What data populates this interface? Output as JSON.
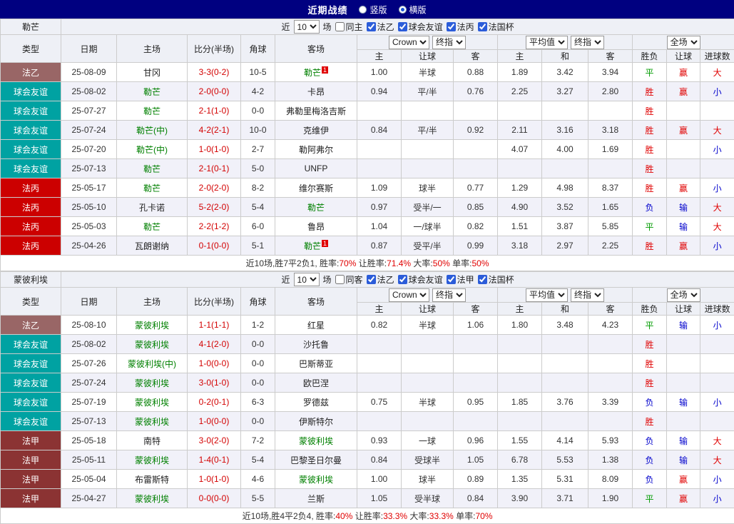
{
  "titlebar": {
    "title": "近期战绩",
    "options": [
      {
        "label": "竖版",
        "selected": false
      },
      {
        "label": "横版",
        "selected": true
      }
    ]
  },
  "colors": {
    "navy": "#000080",
    "win": "#e00000",
    "lose": "#0000cc",
    "draw": "#009b00",
    "score": "#d30000",
    "focus_team": "#008000",
    "leagues": {
      "法乙": "#996666",
      "球会友谊": "#00a2a2",
      "法丙": "#cc0000",
      "法甲": "#8b3333"
    }
  },
  "ui": {
    "near": "近",
    "matches_suffix": "场",
    "col_type": "类型",
    "col_date": "日期",
    "col_home": "主场",
    "col_score": "比分(半场)",
    "col_corner": "角球",
    "col_away": "客场",
    "select_odds": "Crown",
    "select_stage": "终指",
    "select_avg": "平均值",
    "select_scope": "全场",
    "sub_home": "主",
    "sub_handicap": "让球",
    "sub_away": "客",
    "sub_avg_home": "主",
    "sub_avg_draw": "和",
    "sub_avg_away": "客",
    "sub_result": "胜负",
    "sub_let": "让球",
    "sub_goals": "进球数"
  },
  "tables": [
    {
      "team": "勒芒",
      "filter": {
        "count": "10",
        "same_label": "同主",
        "same_checked": false,
        "leagues": [
          {
            "label": "法乙",
            "checked": true
          },
          {
            "label": "球会友谊",
            "checked": true
          },
          {
            "label": "法丙",
            "checked": true
          },
          {
            "label": "法国杯",
            "checked": true
          }
        ]
      },
      "rows": [
        {
          "league": "法乙",
          "date": "25-08-09",
          "home": "甘冈",
          "score": "3-3(0-2)",
          "corner": "10-5",
          "away": "勒芒",
          "badge": "1",
          "odds": [
            "1.00",
            "半球",
            "0.88"
          ],
          "avg": [
            "1.89",
            "3.42",
            "3.94"
          ],
          "res": "平",
          "let": "赢",
          "goals": "大"
        },
        {
          "league": "球会友谊",
          "date": "25-08-02",
          "home": "勒芒",
          "score": "2-0(0-0)",
          "corner": "4-2",
          "away": "卡昂",
          "odds": [
            "0.94",
            "平/半",
            "0.76"
          ],
          "avg": [
            "2.25",
            "3.27",
            "2.80"
          ],
          "res": "胜",
          "let": "赢",
          "goals": "小"
        },
        {
          "league": "球会友谊",
          "date": "25-07-27",
          "home": "勒芒",
          "score": "2-1(1-0)",
          "corner": "0-0",
          "away": "弗勒里梅洛吉斯",
          "odds": [
            "",
            "",
            ""
          ],
          "avg": [
            "",
            "",
            ""
          ],
          "res": "胜",
          "let": "",
          "goals": ""
        },
        {
          "league": "球会友谊",
          "date": "25-07-24",
          "home": "勒芒(中)",
          "score": "4-2(2-1)",
          "corner": "10-0",
          "away": "克维伊",
          "odds": [
            "0.84",
            "平/半",
            "0.92"
          ],
          "avg": [
            "2.11",
            "3.16",
            "3.18"
          ],
          "res": "胜",
          "let": "赢",
          "goals": "大"
        },
        {
          "league": "球会友谊",
          "date": "25-07-20",
          "home": "勒芒(中)",
          "score": "1-0(1-0)",
          "corner": "2-7",
          "away": "勒阿弗尔",
          "odds": [
            "",
            "",
            ""
          ],
          "avg": [
            "4.07",
            "4.00",
            "1.69"
          ],
          "res": "胜",
          "let": "",
          "goals": "小"
        },
        {
          "league": "球会友谊",
          "date": "25-07-13",
          "home": "勒芒",
          "score": "2-1(0-1)",
          "corner": "5-0",
          "away": "UNFP",
          "odds": [
            "",
            "",
            ""
          ],
          "avg": [
            "",
            "",
            ""
          ],
          "res": "胜",
          "let": "",
          "goals": ""
        },
        {
          "league": "法丙",
          "date": "25-05-17",
          "home": "勒芒",
          "score": "2-0(2-0)",
          "corner": "8-2",
          "away": "维尔赛斯",
          "odds": [
            "1.09",
            "球半",
            "0.77"
          ],
          "avg": [
            "1.29",
            "4.98",
            "8.37"
          ],
          "res": "胜",
          "let": "赢",
          "goals": "小"
        },
        {
          "league": "法丙",
          "date": "25-05-10",
          "home": "孔卡诺",
          "score": "5-2(2-0)",
          "corner": "5-4",
          "away": "勒芒",
          "odds": [
            "0.97",
            "受半/一",
            "0.85"
          ],
          "avg": [
            "4.90",
            "3.52",
            "1.65"
          ],
          "res": "负",
          "let": "输",
          "goals": "大"
        },
        {
          "league": "法丙",
          "date": "25-05-03",
          "home": "勒芒",
          "score": "2-2(1-2)",
          "corner": "6-0",
          "away": "鲁昂",
          "odds": [
            "1.04",
            "一/球半",
            "0.82"
          ],
          "avg": [
            "1.51",
            "3.87",
            "5.85"
          ],
          "res": "平",
          "let": "输",
          "goals": "大"
        },
        {
          "league": "法丙",
          "date": "25-04-26",
          "home": "瓦朗谢纳",
          "score": "0-1(0-0)",
          "corner": "5-1",
          "away": "勒芒",
          "badge": "1",
          "odds": [
            "0.87",
            "受平/半",
            "0.99"
          ],
          "avg": [
            "3.18",
            "2.97",
            "2.25"
          ],
          "res": "胜",
          "let": "赢",
          "goals": "小"
        }
      ],
      "summary": [
        {
          "t": "近10场,胜7平2负1, 胜率:",
          "red": false
        },
        {
          "t": "70%",
          "red": true
        },
        {
          "t": " 让胜率:",
          "red": false
        },
        {
          "t": "71.4%",
          "red": true
        },
        {
          "t": " 大率:",
          "red": false
        },
        {
          "t": "50%",
          "red": true
        },
        {
          "t": " 单率:",
          "red": false
        },
        {
          "t": "50%",
          "red": true
        }
      ]
    },
    {
      "team": "蒙彼利埃",
      "filter": {
        "count": "10",
        "same_label": "同客",
        "same_checked": false,
        "leagues": [
          {
            "label": "法乙",
            "checked": true
          },
          {
            "label": "球会友谊",
            "checked": true
          },
          {
            "label": "法甲",
            "checked": true
          },
          {
            "label": "法国杯",
            "checked": true
          }
        ]
      },
      "rows": [
        {
          "league": "法乙",
          "date": "25-08-10",
          "home": "蒙彼利埃",
          "score": "1-1(1-1)",
          "corner": "1-2",
          "away": "红星",
          "odds": [
            "0.82",
            "半球",
            "1.06"
          ],
          "avg": [
            "1.80",
            "3.48",
            "4.23"
          ],
          "res": "平",
          "let": "输",
          "goals": "小"
        },
        {
          "league": "球会友谊",
          "date": "25-08-02",
          "home": "蒙彼利埃",
          "score": "4-1(2-0)",
          "corner": "0-0",
          "away": "沙托鲁",
          "odds": [
            "",
            "",
            ""
          ],
          "avg": [
            "",
            "",
            ""
          ],
          "res": "胜",
          "let": "",
          "goals": ""
        },
        {
          "league": "球会友谊",
          "date": "25-07-26",
          "home": "蒙彼利埃(中)",
          "score": "1-0(0-0)",
          "corner": "0-0",
          "away": "巴斯蒂亚",
          "odds": [
            "",
            "",
            ""
          ],
          "avg": [
            "",
            "",
            ""
          ],
          "res": "胜",
          "let": "",
          "goals": ""
        },
        {
          "league": "球会友谊",
          "date": "25-07-24",
          "home": "蒙彼利埃",
          "score": "3-0(1-0)",
          "corner": "0-0",
          "away": "欧巴涅",
          "odds": [
            "",
            "",
            ""
          ],
          "avg": [
            "",
            "",
            ""
          ],
          "res": "胜",
          "let": "",
          "goals": ""
        },
        {
          "league": "球会友谊",
          "date": "25-07-19",
          "home": "蒙彼利埃",
          "score": "0-2(0-1)",
          "corner": "6-3",
          "away": "罗德兹",
          "odds": [
            "0.75",
            "半球",
            "0.95"
          ],
          "avg": [
            "1.85",
            "3.76",
            "3.39"
          ],
          "res": "负",
          "let": "输",
          "goals": "小"
        },
        {
          "league": "球会友谊",
          "date": "25-07-13",
          "home": "蒙彼利埃",
          "score": "1-0(0-0)",
          "corner": "0-0",
          "away": "伊斯特尔",
          "odds": [
            "",
            "",
            ""
          ],
          "avg": [
            "",
            "",
            ""
          ],
          "res": "胜",
          "let": "",
          "goals": ""
        },
        {
          "league": "法甲",
          "date": "25-05-18",
          "home": "南特",
          "score": "3-0(2-0)",
          "corner": "7-2",
          "away": "蒙彼利埃",
          "odds": [
            "0.93",
            "一球",
            "0.96"
          ],
          "avg": [
            "1.55",
            "4.14",
            "5.93"
          ],
          "res": "负",
          "let": "输",
          "goals": "大"
        },
        {
          "league": "法甲",
          "date": "25-05-11",
          "home": "蒙彼利埃",
          "score": "1-4(0-1)",
          "corner": "5-4",
          "away": "巴黎圣日尔曼",
          "odds": [
            "0.84",
            "受球半",
            "1.05"
          ],
          "avg": [
            "6.78",
            "5.53",
            "1.38"
          ],
          "res": "负",
          "let": "输",
          "goals": "大"
        },
        {
          "league": "法甲",
          "date": "25-05-04",
          "home": "布雷斯特",
          "score": "1-0(1-0)",
          "corner": "4-6",
          "away": "蒙彼利埃",
          "odds": [
            "1.00",
            "球半",
            "0.89"
          ],
          "avg": [
            "1.35",
            "5.31",
            "8.09"
          ],
          "res": "负",
          "let": "赢",
          "goals": "小"
        },
        {
          "league": "法甲",
          "date": "25-04-27",
          "home": "蒙彼利埃",
          "score": "0-0(0-0)",
          "corner": "5-5",
          "away": "兰斯",
          "odds": [
            "1.05",
            "受半球",
            "0.84"
          ],
          "avg": [
            "3.90",
            "3.71",
            "1.90"
          ],
          "res": "平",
          "let": "赢",
          "goals": "小"
        }
      ],
      "summary": [
        {
          "t": "近10场,胜4平2负4, 胜率:",
          "red": false
        },
        {
          "t": "40%",
          "red": true
        },
        {
          "t": " 让胜率:",
          "red": false
        },
        {
          "t": "33.3%",
          "red": true
        },
        {
          "t": " 大率:",
          "red": false
        },
        {
          "t": "33.3%",
          "red": true
        },
        {
          "t": " 单率:",
          "red": false
        },
        {
          "t": "70%",
          "red": true
        }
      ]
    }
  ]
}
